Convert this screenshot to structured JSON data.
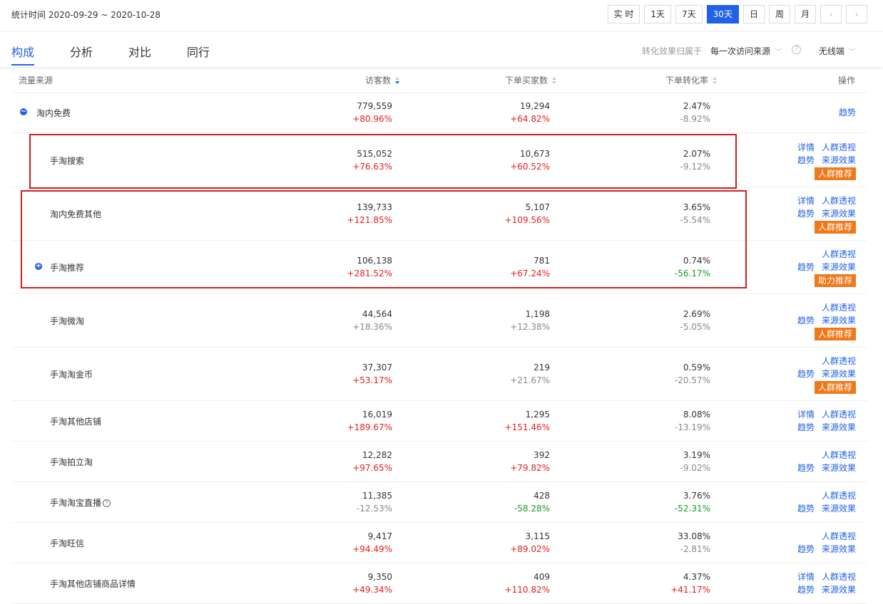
{
  "header": {
    "stat_time": "统计时间 2020-09-29 ~ 2020-10-28",
    "periods": [
      "实 时",
      "1天",
      "7天",
      "30天",
      "日",
      "周",
      "月"
    ],
    "active_period": "30天",
    "prev_icon": "chevron-left-icon",
    "next_icon": "chevron-right-icon"
  },
  "tabs": [
    "构成",
    "分析",
    "对比",
    "同行"
  ],
  "active_tab": "构成",
  "filters": {
    "attribution_label": "转化效果归属于",
    "attribution_value": "每一次访问来源",
    "device_value": "无线端"
  },
  "columns": {
    "source": "流量来源",
    "visitors": "访客数",
    "buyers": "下单买家数",
    "conversion": "下单转化率",
    "actions": "操作"
  },
  "actions": {
    "detail": "详情",
    "crowd": "人群透视",
    "trend": "趋势",
    "effect": "来源效果",
    "crowd_recommend": "人群推荐",
    "assist_recommend": "助力推荐"
  },
  "colors": {
    "accent": "#2062e6",
    "up": "#e02020",
    "down": "#1a9a2e",
    "badge": "#f07818",
    "highlight_box": "#d21e1e"
  },
  "rows": [
    {
      "name": "淘内免费",
      "visitors": "779,559",
      "visitors_change": "+80.96%",
      "buyers": "19,294",
      "buyers_change": "+64.82%",
      "conversion": "2.47%",
      "conversion_change": "-8.92%"
    },
    {
      "name": "手淘搜索",
      "visitors": "515,052",
      "visitors_change": "+76.63%",
      "buyers": "10,673",
      "buyers_change": "+60.52%",
      "conversion": "2.07%",
      "conversion_change": "-9.12%"
    },
    {
      "name": "淘内免费其他",
      "visitors": "139,733",
      "visitors_change": "+121.85%",
      "buyers": "5,107",
      "buyers_change": "+109.56%",
      "conversion": "3.65%",
      "conversion_change": "-5.54%"
    },
    {
      "name": "手淘推荐",
      "visitors": "106,138",
      "visitors_change": "+281.52%",
      "buyers": "781",
      "buyers_change": "+67.24%",
      "conversion": "0.74%",
      "conversion_change": "-56.17%"
    },
    {
      "name": "手淘微淘",
      "visitors": "44,564",
      "visitors_change": "+18.36%",
      "buyers": "1,198",
      "buyers_change": "+12.38%",
      "conversion": "2.69%",
      "conversion_change": "-5.05%"
    },
    {
      "name": "手淘淘金币",
      "visitors": "37,307",
      "visitors_change": "+53.17%",
      "buyers": "219",
      "buyers_change": "+21.67%",
      "conversion": "0.59%",
      "conversion_change": "-20.57%"
    },
    {
      "name": "手淘其他店铺",
      "visitors": "16,019",
      "visitors_change": "+189.67%",
      "buyers": "1,295",
      "buyers_change": "+151.46%",
      "conversion": "8.08%",
      "conversion_change": "-13.19%"
    },
    {
      "name": "手淘拍立淘",
      "visitors": "12,282",
      "visitors_change": "+97.65%",
      "buyers": "392",
      "buyers_change": "+79.82%",
      "conversion": "3.19%",
      "conversion_change": "-9.02%"
    },
    {
      "name": "手淘淘宝直播",
      "visitors": "11,385",
      "visitors_change": "-12.53%",
      "buyers": "428",
      "buyers_change": "-58.28%",
      "conversion": "3.76%",
      "conversion_change": "-52.31%"
    },
    {
      "name": "手淘旺信",
      "visitors": "9,417",
      "visitors_change": "+94.49%",
      "buyers": "3,115",
      "buyers_change": "+89.02%",
      "conversion": "33.08%",
      "conversion_change": "-2.81%"
    },
    {
      "name": "手淘其他店铺商品详情",
      "visitors": "9,350",
      "visitors_change": "+49.34%",
      "buyers": "409",
      "buyers_change": "+110.82%",
      "conversion": "4.37%",
      "conversion_change": "+41.17%"
    }
  ]
}
